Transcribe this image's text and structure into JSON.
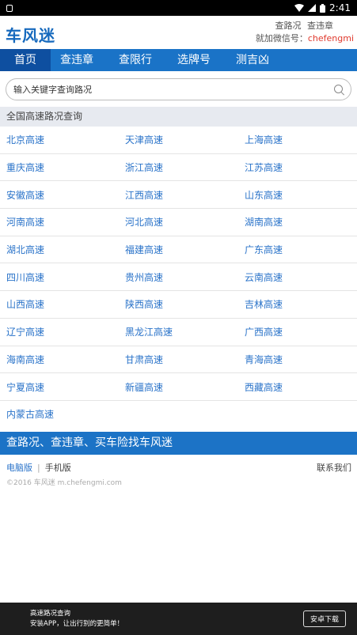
{
  "status_bar": {
    "time": "2:41"
  },
  "header": {
    "logo": "车风迷",
    "links": [
      "查路况",
      "查违章"
    ],
    "wechat_label": "就加微信号：",
    "wechat_id": "chefengmi"
  },
  "nav": {
    "items": [
      {
        "label": "首页"
      },
      {
        "label": "查违章"
      },
      {
        "label": "查限行"
      },
      {
        "label": "选牌号"
      },
      {
        "label": "测吉凶"
      }
    ]
  },
  "search": {
    "placeholder": "输入关键字查询路况"
  },
  "section": {
    "title": "全国高速路况查询"
  },
  "highways": [
    [
      "北京高速",
      "天津高速",
      "上海高速"
    ],
    [
      "重庆高速",
      "浙江高速",
      "江苏高速"
    ],
    [
      "安徽高速",
      "江西高速",
      "山东高速"
    ],
    [
      "河南高速",
      "河北高速",
      "湖南高速"
    ],
    [
      "湖北高速",
      "福建高速",
      "广东高速"
    ],
    [
      "四川高速",
      "贵州高速",
      "云南高速"
    ],
    [
      "山西高速",
      "陕西高速",
      "吉林高速"
    ],
    [
      "辽宁高速",
      "黑龙江高速",
      "广西高速"
    ],
    [
      "海南高速",
      "甘肃高速",
      "青海高速"
    ],
    [
      "宁夏高速",
      "新疆高速",
      "西藏高速"
    ],
    [
      "内蒙古高速",
      "",
      ""
    ]
  ],
  "banner": {
    "text": "查路况、查违章、买车险找车风迷"
  },
  "footer": {
    "desktop": "电脑版",
    "mobile": "手机版",
    "contact": "联系我们",
    "copyright": "©2016 车风迷 m.chefengmi.com"
  },
  "app_bar": {
    "line1": "高速路况查询",
    "line2": "安装APP，让出行别的更简单！",
    "button": "安卓下载"
  }
}
